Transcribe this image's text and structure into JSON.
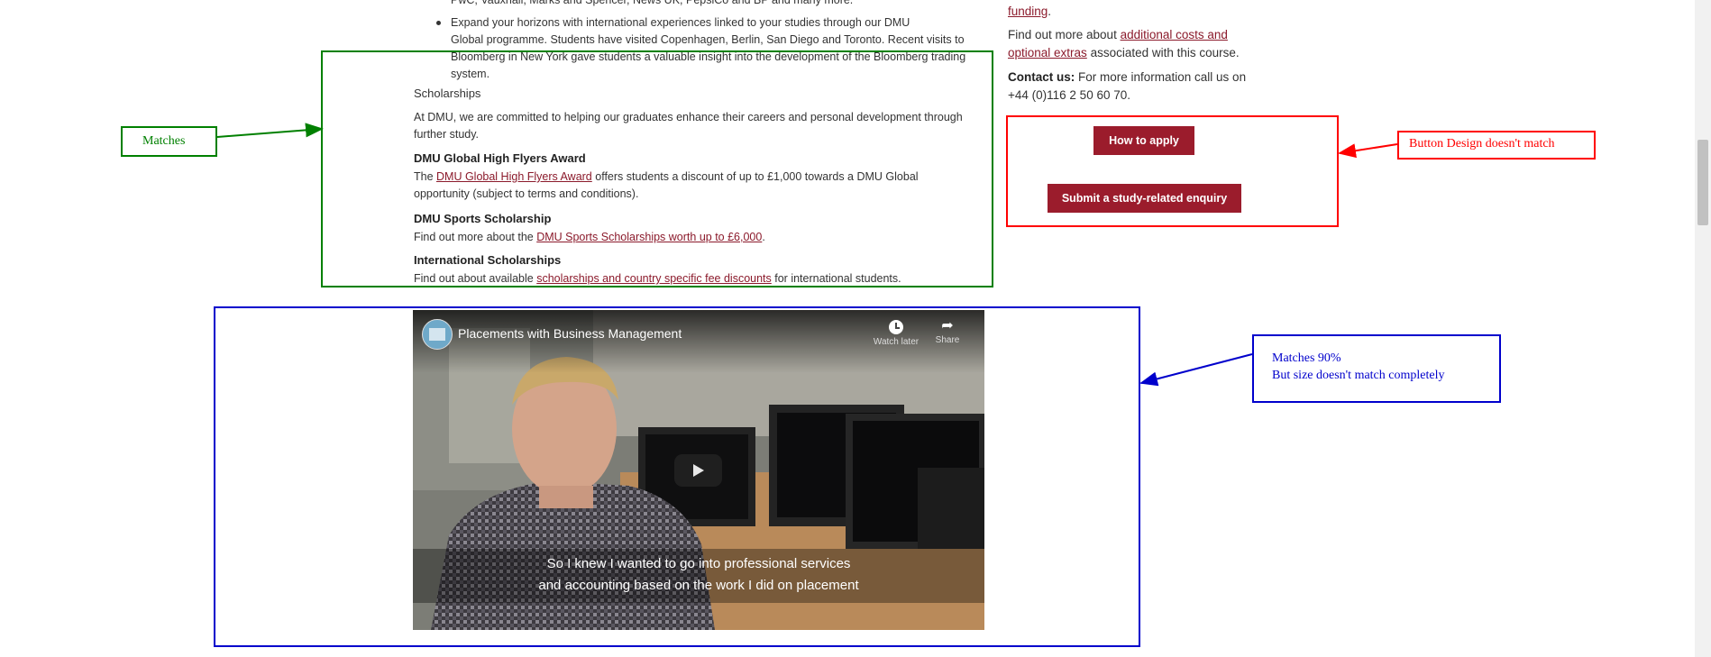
{
  "left_column": {
    "bullet_top_tail": "PwC, Vauxhall, Marks and Spencer, News UK, PepsiCo and BP and many more.",
    "bullet_global": [
      "Expand your horizons with international experiences linked to your studies through our DMU",
      "Global programme. Students have visited Copenhagen, Berlin, San Diego and Toronto. Recent visits to",
      "Bloomberg in New York gave students a valuable insight into the development of the Bloomberg trading",
      "system."
    ],
    "scholarships_heading": "Scholarships",
    "scholarships_intro": [
      "At DMU, we are committed to helping our graduates enhance their careers and personal development through",
      "further study."
    ],
    "high_flyers": {
      "heading": "DMU Global High Flyers Award",
      "line1_prefix": "The ",
      "line1_link": "DMU Global High Flyers Award",
      "line1_suffix": " offers students a discount of up to £1,000 towards a DMU Global",
      "line2": "opportunity (subject to terms and conditions)."
    },
    "sports": {
      "heading": "DMU Sports Scholarship",
      "prefix": "Find out more about the ",
      "link": "DMU Sports Scholarships worth up to £6,000",
      "suffix": "."
    },
    "international": {
      "heading": "International Scholarships",
      "prefix": "Find out about available ",
      "link": "scholarships and country specific fee discounts",
      "suffix": " for international students."
    }
  },
  "right_column": {
    "funding_link": "funding",
    "funding_suffix": ".",
    "costs_prefix": "Find out more about ",
    "costs_link_line1": "additional costs and",
    "costs_link_line2": "optional extras",
    "costs_suffix": " associated with this course.",
    "contact_label": "Contact us:",
    "contact_text": " For more information call us on",
    "contact_phone": "+44 (0)116 2 50 60 70.",
    "how_to_apply": "How to apply",
    "enquiry": "Submit a study-related enquiry"
  },
  "video": {
    "title": "Placements with Business Management",
    "watch_later": "Watch later",
    "share": "Share",
    "caption_line1": "So I knew I wanted to go into professional services",
    "caption_line2": "and accounting based on the work I did on placement"
  },
  "annotations": {
    "matches": "Matches",
    "button_mismatch": "Button Design doesn't match",
    "video_line1": "Matches 90%",
    "video_line2": "But size doesn't match completely"
  },
  "colors": {
    "brand_red": "#9b1c2c",
    "link": "#8b1a2b",
    "annot_green": "#008000",
    "annot_red": "#ff0000",
    "annot_blue": "#0000cc"
  }
}
